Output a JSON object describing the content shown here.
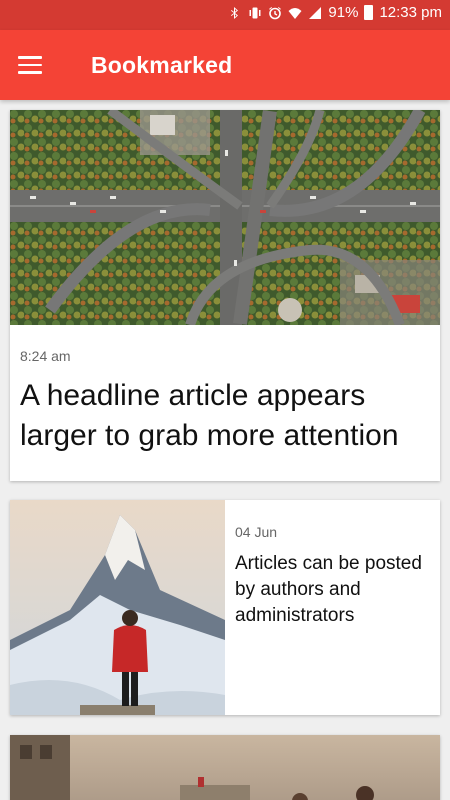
{
  "status_bar": {
    "battery": "91%",
    "time": "12:33 pm",
    "icons": [
      "bluetooth-icon",
      "vibrate-icon",
      "alarm-icon",
      "wifi-icon",
      "signal-icon",
      "battery-icon"
    ]
  },
  "app_bar": {
    "title": "Bookmarked",
    "menu_icon": "hamburger-menu-icon",
    "background": "#f44336",
    "status_background": "#d43a32"
  },
  "feed": {
    "featured": {
      "date": "8:24 am",
      "headline": "A headline article appears larger to grab more attention",
      "image": "aerial-highway-interchange-image"
    },
    "items": [
      {
        "date": "04 Jun",
        "title": "Articles can be posted by authors and administrators",
        "image": "mountain-hiker-image"
      },
      {
        "image": "city-street-people-image"
      }
    ]
  }
}
